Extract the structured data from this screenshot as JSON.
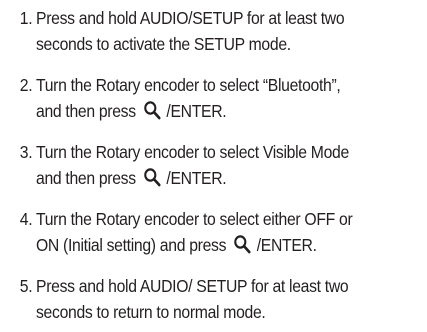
{
  "steps": [
    {
      "number": "1.",
      "line1": "Press and hold AUDIO/SETUP for at least two",
      "line2": "seconds to activate the SETUP mode."
    },
    {
      "number": "2.",
      "line1": "Turn the Rotary encoder to select “Bluetooth”,",
      "line2_before": "and then press",
      "line2_after": "/ENTER.",
      "icon": "magnifier-icon"
    },
    {
      "number": "3.",
      "line1": "Turn the Rotary encoder to select Visible Mode",
      "line2_before": "and then press",
      "line2_after": "/ENTER.",
      "icon": "magnifier-icon"
    },
    {
      "number": "4.",
      "line1": "Turn the Rotary encoder to select either OFF or",
      "line2_before": "ON (Initial setting) and press",
      "line2_after": "/ENTER.",
      "icon": "magnifier-icon"
    },
    {
      "number": "5.",
      "line1": "Press and hold AUDIO/ SETUP for at least two",
      "line2": "seconds to return to normal mode."
    }
  ],
  "colors": {
    "text": "#231f20",
    "background": "#ffffff"
  }
}
